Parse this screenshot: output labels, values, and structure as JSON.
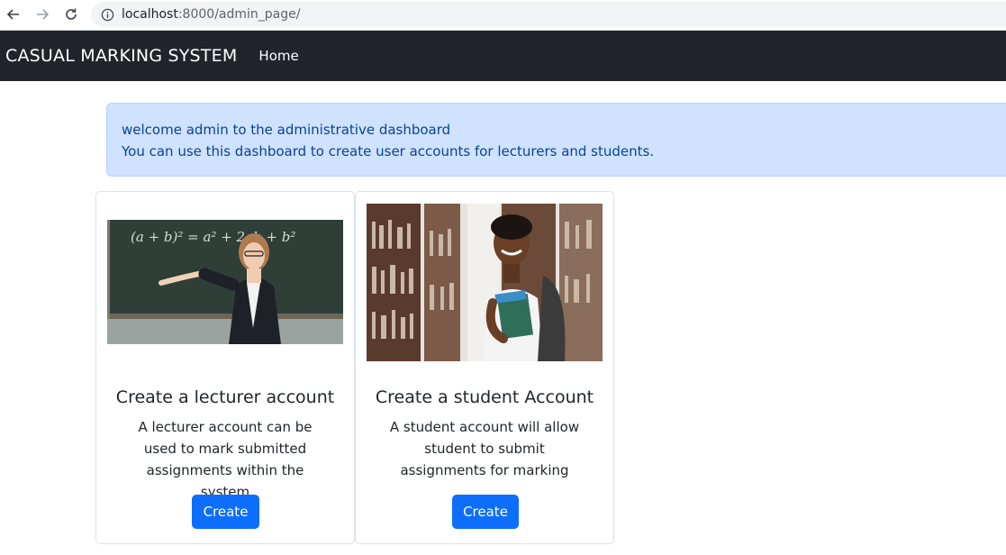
{
  "browser": {
    "url_host": "localhost",
    "url_rest": ":8000/admin_page/"
  },
  "navbar": {
    "brand": "CASUAL MARKING SYSTEM",
    "home": "Home"
  },
  "alert": {
    "line1": "welcome admin to the administrative dashboard",
    "line2": "You can use this dashboard to create user accounts for lecturers and students."
  },
  "cards": {
    "lecturer": {
      "title": "Create a lecturer account",
      "text": "A lecturer account can be used to mark submitted assignments within the system",
      "button": "Create",
      "image_alt": "lecturer at chalkboard photo"
    },
    "student": {
      "title": "Create a student Account",
      "text": "A student account will allow student to submit assignments for marking",
      "button": "Create",
      "image_alt": "student in library photo"
    }
  },
  "colors": {
    "navbar_bg": "#212529",
    "alert_bg": "#cfe2ff",
    "alert_text": "#084298",
    "primary": "#0d6efd"
  }
}
